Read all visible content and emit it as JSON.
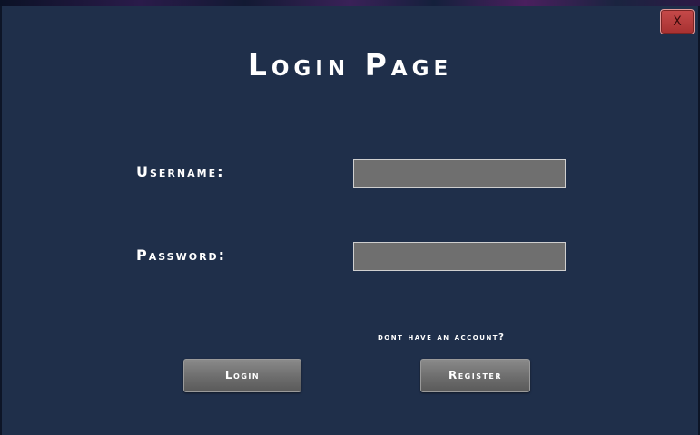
{
  "window": {
    "close_label": "X"
  },
  "page": {
    "title": "Login Page"
  },
  "form": {
    "username_label": "Username:",
    "username_value": "",
    "password_label": "Password:",
    "password_value": "",
    "register_prompt": "dont have an account?",
    "login_label": "Login",
    "register_label": "Register"
  },
  "colors": {
    "background": "#1f2f4a",
    "field": "#6f6f6f",
    "button": "#6d6d6d",
    "close_button": "#b53b3b",
    "text": "#ffffff"
  }
}
